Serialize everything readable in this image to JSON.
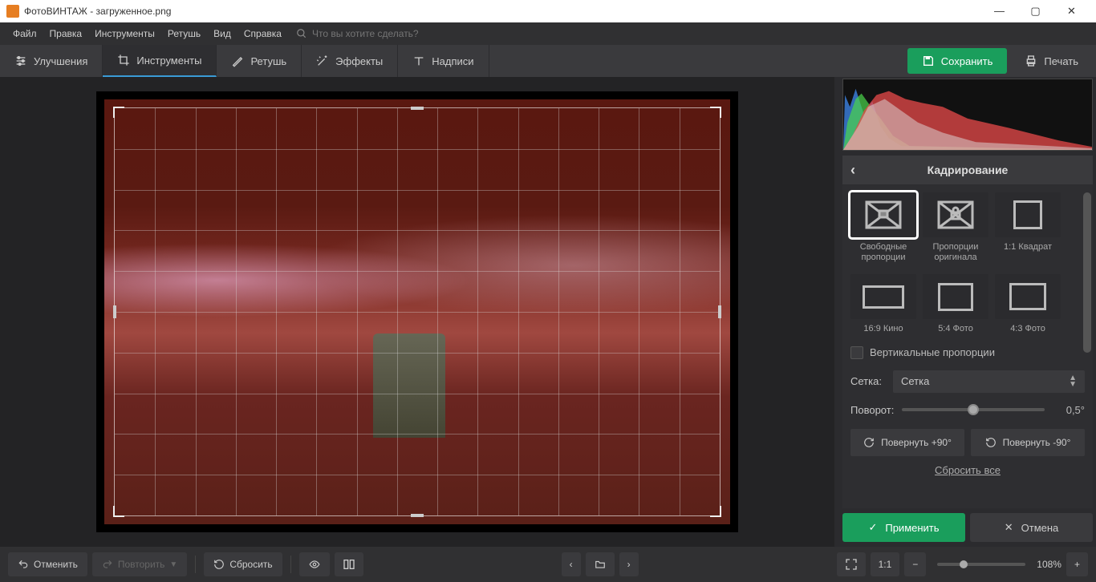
{
  "window": {
    "title": "ФотоВИНТАЖ - загруженное.png"
  },
  "menu": {
    "items": [
      "Файл",
      "Правка",
      "Инструменты",
      "Ретушь",
      "Вид",
      "Справка"
    ],
    "search_placeholder": "Что вы хотите сделать?"
  },
  "tabs": {
    "improve": "Улучшения",
    "tools": "Инструменты",
    "retouch": "Ретушь",
    "effects": "Эффекты",
    "captions": "Надписи"
  },
  "actions": {
    "save": "Сохранить",
    "print": "Печать"
  },
  "crop_panel": {
    "title": "Кадрирование",
    "presets": {
      "free": "Свободные пропорции",
      "orig": "Пропорции оригинала",
      "square": "1:1 Квадрат",
      "cinema": "16:9 Кино",
      "fivefour": "5:4 Фото",
      "fourthree": "4:3 Фото"
    },
    "vertical_checkbox": "Вертикальные пропорции",
    "grid_label": "Сетка:",
    "grid_value": "Сетка",
    "rotate_label": "Поворот:",
    "rotate_value": "0,5°",
    "rotate_plus": "Повернуть +90°",
    "rotate_minus": "Повернуть -90°",
    "reset": "Сбросить все",
    "apply": "Применить",
    "cancel": "Отмена"
  },
  "bottombar": {
    "undo": "Отменить",
    "redo": "Повторить",
    "reset": "Сбросить",
    "ratio": "1:1",
    "zoom": "108%"
  }
}
